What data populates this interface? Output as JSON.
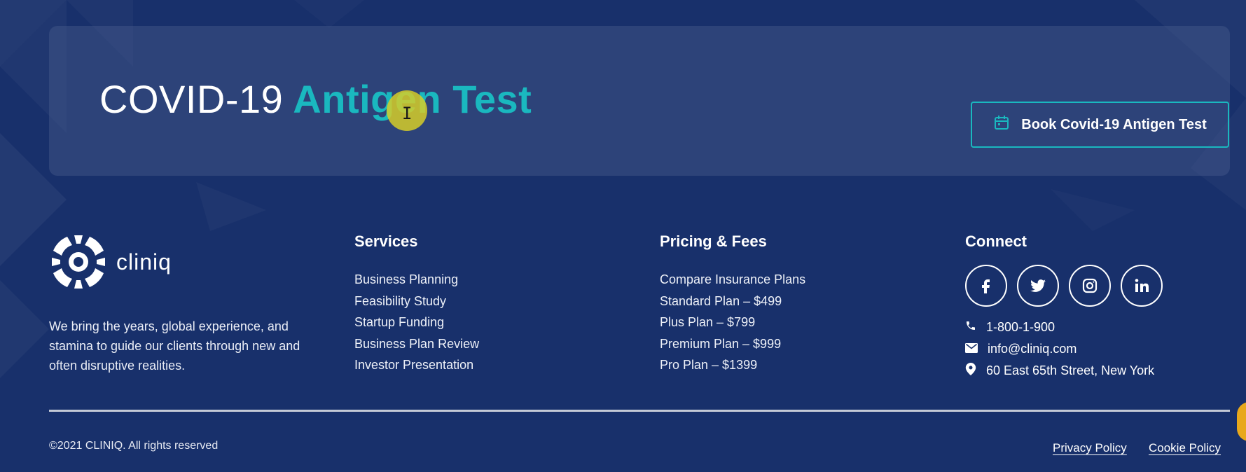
{
  "cta": {
    "title_prefix": "COVID-19",
    "title_accent": "Antigen Test",
    "button_label": "Book Covid-19 Antigen Test",
    "button_icon": "calendar-icon"
  },
  "brand": {
    "name": "cliniq",
    "logo_icon": "cliniq-logo-icon",
    "description": "We bring the years, global experience, and stamina to guide our clients through new and often disruptive realities."
  },
  "services": {
    "title": "Services",
    "items": [
      "Business Planning",
      "Feasibility Study",
      "Startup Funding",
      "Business Plan Review",
      "Investor Presentation"
    ]
  },
  "pricing": {
    "title": "Pricing & Fees",
    "items": [
      "Compare Insurance Plans",
      "Standard Plan – $499",
      "Plus Plan – $799",
      "Premium Plan – $999",
      "Pro Plan – $1399"
    ]
  },
  "connect": {
    "title": "Connect",
    "social": [
      "facebook-icon",
      "twitter-icon",
      "instagram-icon",
      "linkedin-icon"
    ],
    "phone": "1-800-1-900",
    "email": "info@cliniq.com",
    "address": "60 East 65th Street, New York"
  },
  "footer": {
    "copyright": "©2021 CLINIQ. All rights reserved",
    "privacy": "Privacy Policy",
    "cookie": "Cookie Policy"
  },
  "colors": {
    "background": "#18306b",
    "accent": "#1ab8bf",
    "cursor_highlight": "#d6cd28"
  }
}
